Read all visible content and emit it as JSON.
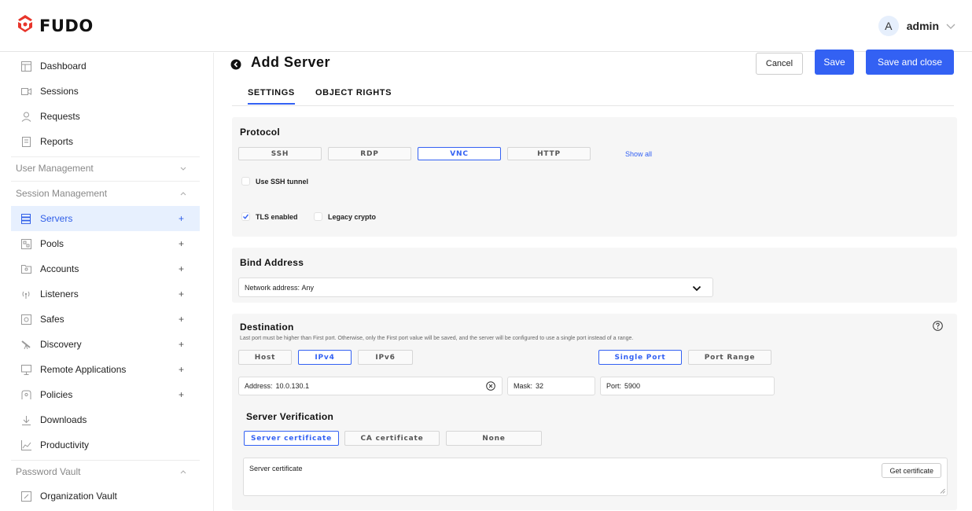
{
  "header": {
    "logo_text": "FUDO",
    "user": {
      "avatar_initial": "A",
      "name": "admin"
    }
  },
  "sidebar": {
    "items": [
      {
        "label": "Dashboard",
        "icon": "dashboard-icon"
      },
      {
        "label": "Sessions",
        "icon": "video-icon"
      },
      {
        "label": "Requests",
        "icon": "user-icon"
      },
      {
        "label": "Reports",
        "icon": "document-icon"
      }
    ],
    "sections": {
      "user_management": "User Management",
      "session_management": "Session Management",
      "password_vault": "Password Vault"
    },
    "session_items": [
      {
        "label": "Servers",
        "plus": "+",
        "active": true
      },
      {
        "label": "Pools",
        "plus": "+"
      },
      {
        "label": "Accounts",
        "plus": "+"
      },
      {
        "label": "Listeners",
        "plus": "+"
      },
      {
        "label": "Safes",
        "plus": "+"
      },
      {
        "label": "Discovery",
        "plus": "+"
      },
      {
        "label": "Remote Applications",
        "plus": "+"
      },
      {
        "label": "Policies",
        "plus": "+"
      },
      {
        "label": "Downloads"
      },
      {
        "label": "Productivity"
      }
    ],
    "vault_items": [
      {
        "label": "Organization Vault"
      }
    ]
  },
  "page": {
    "title": "Add Server",
    "cancel_label": "Cancel",
    "save_label": "Save",
    "save_close_label": "Save and close",
    "tabs": [
      {
        "label": "SETTINGS",
        "active": true
      },
      {
        "label": "OBJECT RIGHTS"
      }
    ]
  },
  "protocol": {
    "title": "Protocol",
    "options": [
      "SSH",
      "RDP",
      "VNC",
      "HTTP"
    ],
    "selected": "VNC",
    "show_all": "Show all",
    "use_ssh_tunnel": "Use SSH tunnel",
    "tls_enabled": "TLS enabled",
    "tls_checked": true,
    "legacy_crypto": "Legacy crypto",
    "legacy_checked": false
  },
  "bind_address": {
    "title": "Bind Address",
    "label": "Network address:",
    "value": "Any"
  },
  "destination": {
    "title": "Destination",
    "helper": "Last port must be higher than First port. Otherwise, only the First port value will be saved, and the server will be configured to use a single port instead of a range.",
    "address_types": [
      "Host",
      "IPv4",
      "IPv6"
    ],
    "address_type_selected": "IPv4",
    "port_modes": [
      "Single Port",
      "Port Range"
    ],
    "port_mode_selected": "Single Port",
    "address_label": "Address:",
    "address_value": "10.0.130.1",
    "mask_label": "Mask:",
    "mask_value": "32",
    "port_label": "Port:",
    "port_value": "5900"
  },
  "server_verification": {
    "title": "Server Verification",
    "options": [
      "Server certificate",
      "CA certificate",
      "None"
    ],
    "selected": "Server certificate",
    "field_label": "Server certificate",
    "get_certificate": "Get certificate"
  },
  "colors": {
    "accent": "#3361f3",
    "logo_red": "#e8352b",
    "active_bg": "#e7f0fe",
    "card_bg": "#f6f6f6"
  }
}
